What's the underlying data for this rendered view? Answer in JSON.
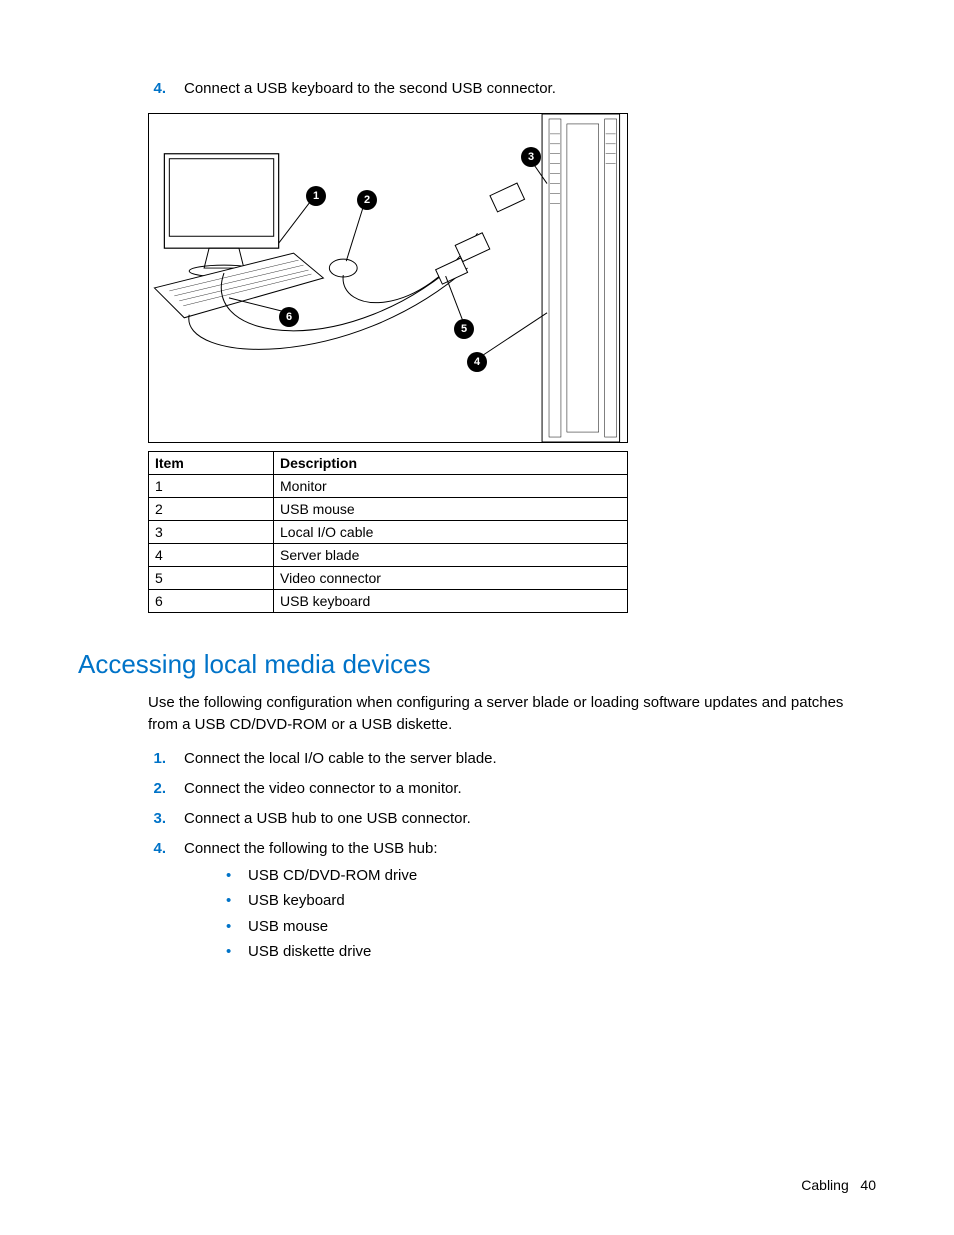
{
  "top_step": {
    "number": "4.",
    "text": "Connect a USB keyboard to the second USB connector."
  },
  "callouts": [
    "1",
    "2",
    "3",
    "4",
    "5",
    "6"
  ],
  "table": {
    "headers": [
      "Item",
      "Description"
    ],
    "rows": [
      [
        "1",
        "Monitor"
      ],
      [
        "2",
        "USB mouse"
      ],
      [
        "3",
        "Local I/O cable"
      ],
      [
        "4",
        "Server blade"
      ],
      [
        "5",
        "Video connector"
      ],
      [
        "6",
        "USB keyboard"
      ]
    ]
  },
  "heading": "Accessing local media devices",
  "intro": "Use the following configuration when configuring a server blade or loading software updates and patches from a USB CD/DVD-ROM or a USB diskette.",
  "steps": [
    {
      "n": "1.",
      "t": "Connect the local I/O cable to the server blade."
    },
    {
      "n": "2.",
      "t": "Connect the video connector to a monitor."
    },
    {
      "n": "3.",
      "t": "Connect a USB hub to one USB connector."
    },
    {
      "n": "4.",
      "t": "Connect the following to the USB hub:"
    }
  ],
  "sub": [
    "USB CD/DVD-ROM drive",
    "USB keyboard",
    "USB mouse",
    "USB diskette drive"
  ],
  "footer": {
    "section": "Cabling",
    "page": "40"
  }
}
